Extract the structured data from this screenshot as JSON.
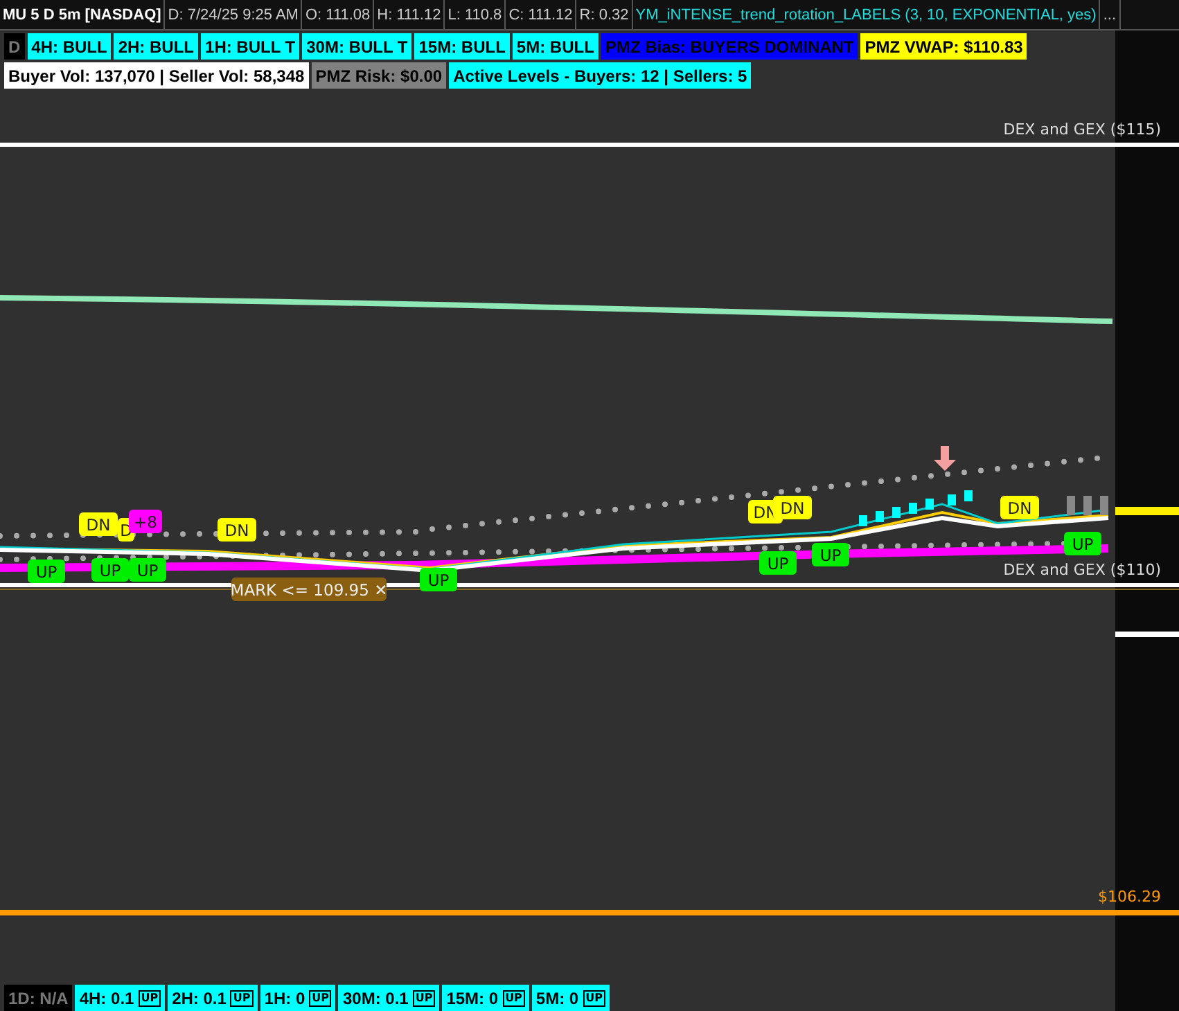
{
  "header": {
    "symbol": "MU 5 D 5m [NASDAQ]",
    "fields": [
      "D: 7/24/25 9:25 AM",
      "O: 111.08",
      "H: 111.12",
      "L: 110.8",
      "C: 111.12",
      "R: 0.32"
    ],
    "study": "YM_iNTENSE_trend_rotation_LABELS (3, 10, EXPONENTIAL, yes)",
    "more": "..."
  },
  "label_rows": [
    [
      {
        "text": "D",
        "color": "#000000"
      },
      {
        "text": "4H: BULL",
        "color": "#00ffff"
      },
      {
        "text": "2H: BULL",
        "color": "#00ffff"
      },
      {
        "text": "1H: BULL T",
        "color": "#00ffff"
      },
      {
        "text": "30M: BULL T",
        "color": "#00ffff"
      },
      {
        "text": "15M: BULL",
        "color": "#00ffff"
      },
      {
        "text": "5M: BULL",
        "color": "#00ffff"
      },
      {
        "text": "PMZ Bias: BUYERS DOMINANT",
        "color": "#0000ff"
      },
      {
        "text": "PMZ VWAP: $110.83",
        "color": "#ffff00"
      }
    ],
    [
      {
        "text": "Buyer Vol: 137,070 | Seller Vol: 58,348",
        "color": "#ffffff"
      },
      {
        "text": "PMZ Risk: $0.00",
        "color": "#808080"
      },
      {
        "text": "Active Levels - Buyers: 12 | Sellers: 5",
        "color": "#00ffff"
      }
    ]
  ],
  "price_levels": [
    {
      "label": "DEX and GEX ($115)",
      "color": "#ffffff"
    },
    {
      "label": "DEX and GEX ($110)",
      "color": "#ffffff"
    },
    {
      "label": "$106.29",
      "color": "#ff9900"
    }
  ],
  "markers": [
    {
      "kind": "dn",
      "text": "DN"
    },
    {
      "kind": "dn",
      "text": "D"
    },
    {
      "kind": "count",
      "text": "+8"
    },
    {
      "kind": "up",
      "text": "UP"
    },
    {
      "kind": "up",
      "text": "UP"
    },
    {
      "kind": "up",
      "text": "UP"
    },
    {
      "kind": "dn",
      "text": "DN"
    },
    {
      "kind": "mark",
      "text": "MARK <= 109.95 ✕"
    },
    {
      "kind": "up",
      "text": "UP"
    },
    {
      "kind": "dn",
      "text": "DN"
    },
    {
      "kind": "dn",
      "text": "DN"
    },
    {
      "kind": "up",
      "text": "UP"
    },
    {
      "kind": "up",
      "text": "UP"
    },
    {
      "kind": "dn",
      "text": "DN"
    },
    {
      "kind": "up",
      "text": "UP"
    }
  ],
  "bottom_labels": [
    {
      "text": "1D: N/A",
      "color": "#000000"
    },
    {
      "text": "4H: 0.1",
      "color": "#00ffff",
      "badge": "UP"
    },
    {
      "text": "2H: 0.1",
      "color": "#00ffff",
      "badge": "UP"
    },
    {
      "text": "1H: 0",
      "color": "#00ffff",
      "badge": "UP"
    },
    {
      "text": "30M: 0.1",
      "color": "#00ffff",
      "badge": "UP"
    },
    {
      "text": "15M: 0",
      "color": "#00ffff",
      "badge": "UP"
    },
    {
      "text": "5M: 0",
      "color": "#00ffff",
      "badge": "UP"
    }
  ]
}
